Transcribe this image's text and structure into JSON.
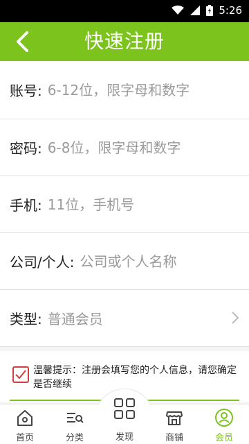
{
  "status_bar": {
    "time": "5:26"
  },
  "header": {
    "title": "快速注册"
  },
  "form": {
    "account": {
      "label": "账号:",
      "placeholder": "6-12位，限字母和数字"
    },
    "password": {
      "label": "密码:",
      "placeholder": "6-8位，限字母和数字"
    },
    "phone": {
      "label": "手机:",
      "placeholder": "11位，手机号"
    },
    "company": {
      "label": "公司/个人:",
      "placeholder": "公司或个人名称"
    },
    "type": {
      "label": "类型:",
      "value": "普通会员"
    }
  },
  "notice": {
    "text": "温馨提示：注册会填写您的个人信息，请您确定是否继续",
    "checked": true
  },
  "bottom_nav": {
    "items": [
      {
        "label": "首页",
        "icon": "home-icon"
      },
      {
        "label": "分类",
        "icon": "category-icon"
      },
      {
        "label": "发现",
        "icon": "discover-icon"
      },
      {
        "label": "商铺",
        "icon": "shop-icon"
      },
      {
        "label": "会员",
        "icon": "member-icon",
        "active": true
      }
    ]
  },
  "colors": {
    "accent": "#7cc31e",
    "checkbox": "#d04040"
  }
}
